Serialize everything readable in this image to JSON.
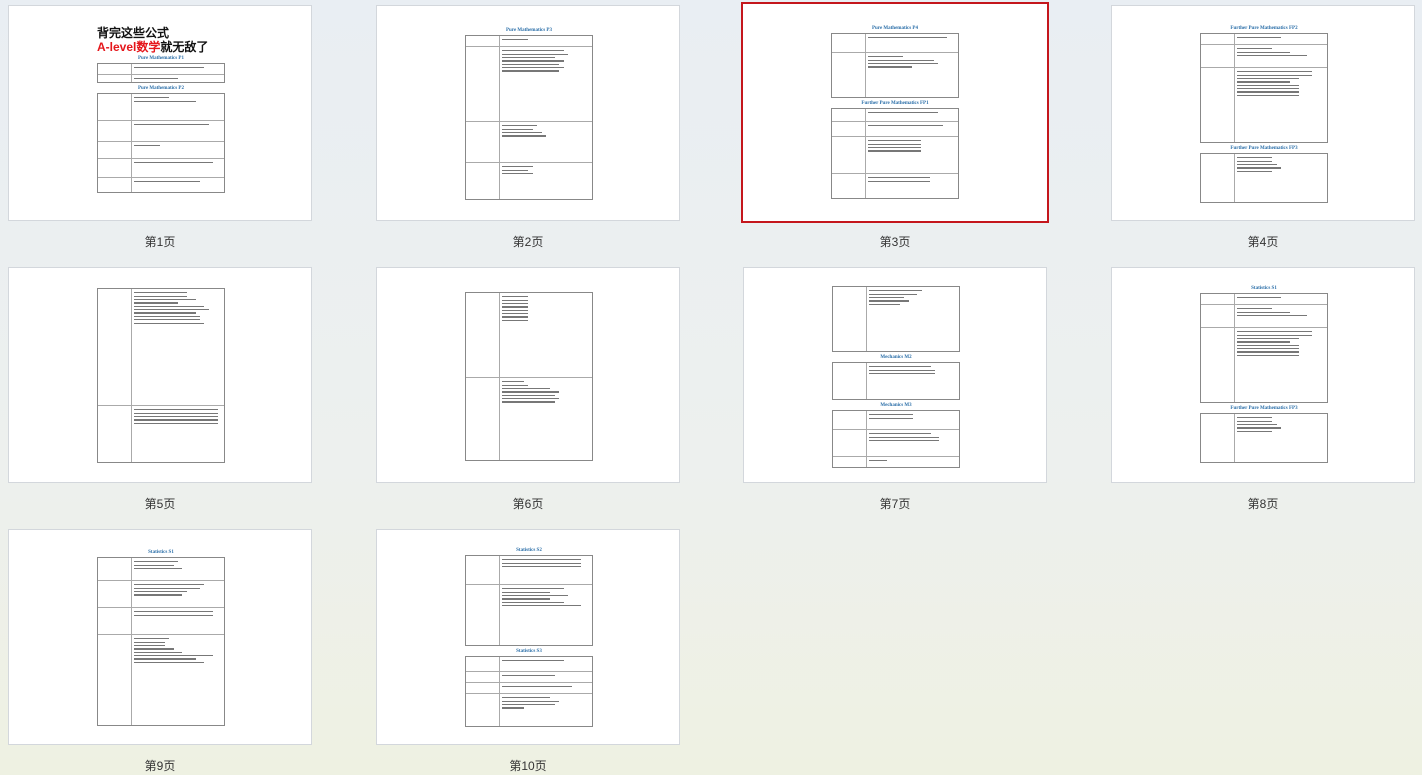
{
  "pages": [
    {
      "label": "第1页",
      "selected": false,
      "cover_line1": "背完这些公式",
      "cover_line2_red": "A-level数学",
      "cover_line2_black": "就无敌了",
      "headings": [
        "Pure Mathematics P1",
        "Pure Mathematics P2"
      ]
    },
    {
      "label": "第2页",
      "selected": false,
      "headings": [
        "Pure Mathematics P3"
      ]
    },
    {
      "label": "第3页",
      "selected": true,
      "headings": [
        "Pure Mathematics P4",
        "Further Pure Mathematics FP1"
      ]
    },
    {
      "label": "第4页",
      "selected": false,
      "headings": [
        "Further Pure Mathematics FP2",
        "Further Pure Mathematics FP3"
      ]
    },
    {
      "label": "第5页",
      "selected": false,
      "headings": []
    },
    {
      "label": "第6页",
      "selected": false,
      "headings": []
    },
    {
      "label": "第7页",
      "selected": false,
      "headings": [
        "Mechanics M2",
        "Mechanics M3"
      ]
    },
    {
      "label": "第8页",
      "selected": false,
      "headings": [
        "Statistics S1",
        "Further Pure Mathematics FP3"
      ]
    },
    {
      "label": "第9页",
      "selected": false,
      "headings": [
        "Statistics S1"
      ]
    },
    {
      "label": "第10页",
      "selected": false,
      "headings": [
        "Statistics S2",
        "Statistics S3"
      ]
    }
  ],
  "colors": {
    "selected_border": "#c4161c",
    "heading_blue": "#2a6ea8",
    "cover_red": "#e5161b"
  }
}
